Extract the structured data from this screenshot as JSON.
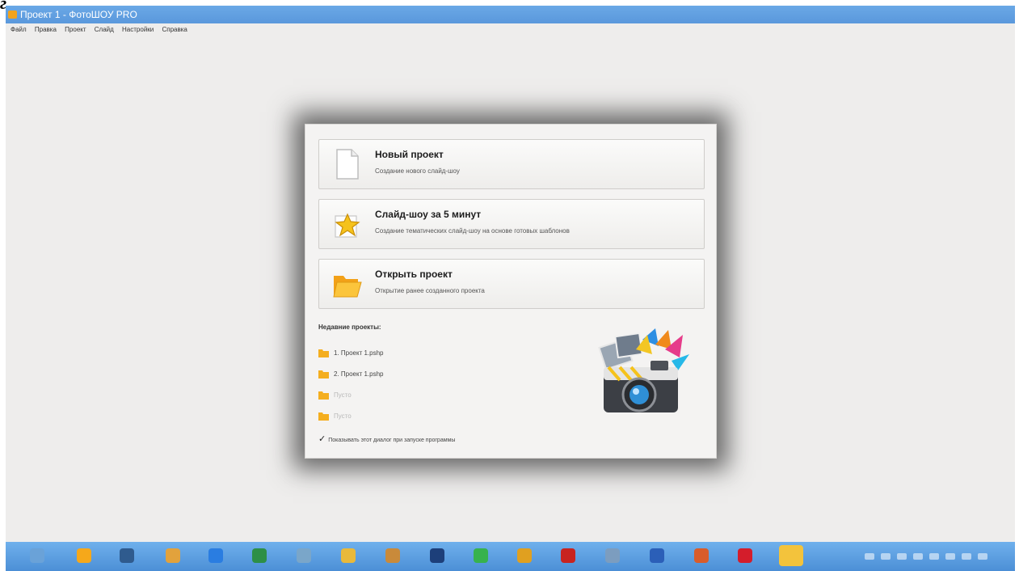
{
  "corner_mark": "г",
  "window": {
    "title": "Проект 1 - ФотоШОУ PRO"
  },
  "menu": [
    "Файл",
    "Правка",
    "Проект",
    "Слайд",
    "Настройки",
    "Справка"
  ],
  "dialog": {
    "actions": [
      {
        "title": "Новый проект",
        "desc": "Создание нового слайд-шоу",
        "icon": "blank-document-icon"
      },
      {
        "title": "Слайд-шоу за 5 минут",
        "desc": "Создание тематических слайд-шоу на основе готовых шаблонов",
        "icon": "star-icon"
      },
      {
        "title": "Открыть проект",
        "desc": "Открытие ранее созданного проекта",
        "icon": "open-folder-icon"
      }
    ],
    "recent_heading": "Недавние проекты:",
    "recent": [
      "1. Проект 1.pshp",
      "2. Проект 1.pshp",
      "Пусто",
      "Пусто"
    ],
    "startup_checkbox_label": "Показывать этот диалог при запуске программы",
    "startup_checkbox_checked": true
  },
  "taskbar": {
    "icons": [
      "start-orb-icon",
      "paint-icon",
      "plane-icon",
      "puzzle-icon",
      "internet-explorer-icon",
      "excel-icon",
      "network-icon",
      "smiley-icon",
      "tool-icon",
      "headset-icon",
      "a-app-icon",
      "chrome-icon",
      "pdf-icon",
      "files-icon",
      "word-icon",
      "photo-app-icon",
      "opera-icon",
      "fotoshow-icon"
    ],
    "colors": [
      "#6aa2d8",
      "#f6a81a",
      "#2f5b8e",
      "#e2a23c",
      "#2a7de1",
      "#2d8f47",
      "#7aa6c9",
      "#e8b93b",
      "#c98a3a",
      "#1d3f7a",
      "#37b24d",
      "#e0a020",
      "#c8231f",
      "#7c9dbf",
      "#2b5fb8",
      "#d95c2a",
      "#d41d2b",
      "#f3c33c"
    ]
  },
  "colors": {
    "titlebar": "#5a98dc",
    "taskbar": "#4c8fd6",
    "dialog_bg": "#f4f3f2"
  }
}
